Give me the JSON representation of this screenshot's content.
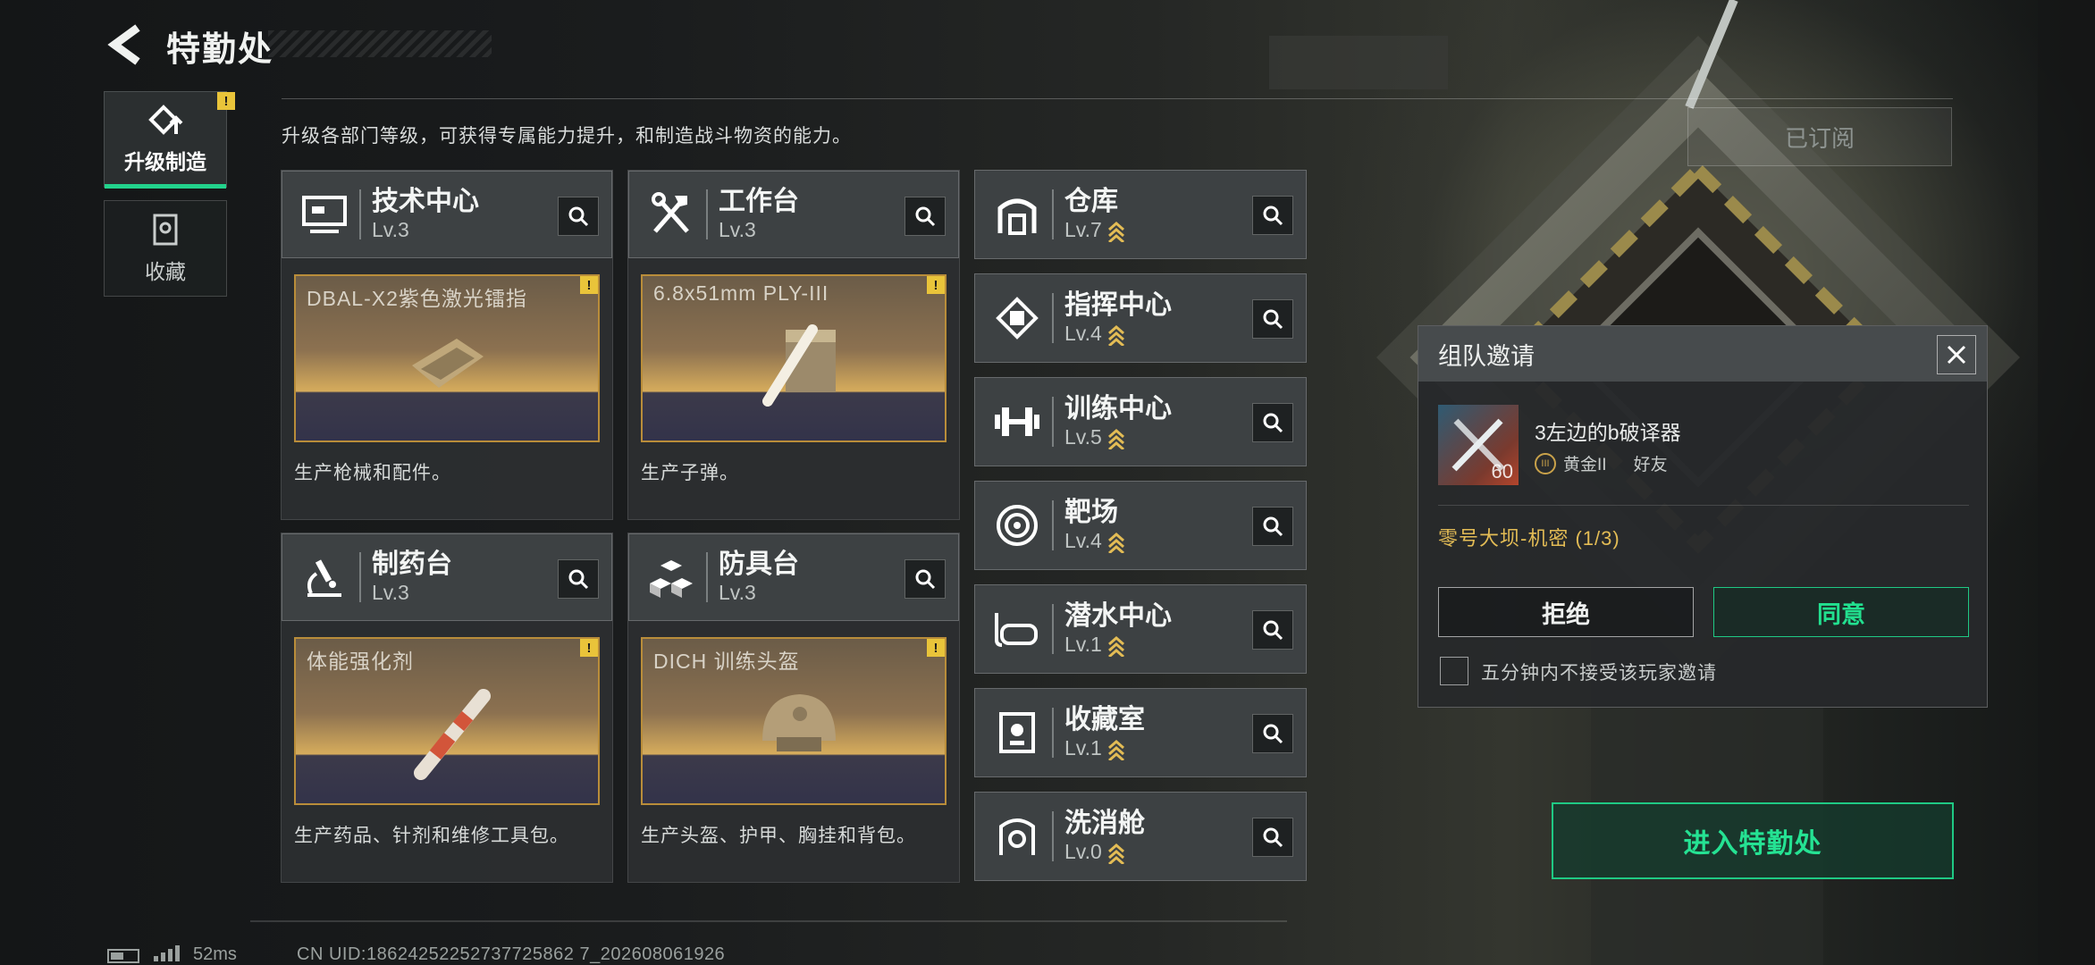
{
  "header": {
    "title": "特勤处"
  },
  "sidebar": {
    "tabs": [
      {
        "label": "升级制造"
      },
      {
        "label": "收藏"
      }
    ]
  },
  "description": "升级各部门等级，可获得专属能力提升，和制造战斗物资的能力。",
  "subscribed_label": "已订阅",
  "departments_large": [
    {
      "name": "技术中心",
      "level": "Lv.3",
      "product": "DBAL-X2紫色激光镭指",
      "desc": "生产枪械和配件。",
      "icon": "monitor-icon"
    },
    {
      "name": "工作台",
      "level": "Lv.3",
      "product": "6.8x51mm PLY-III",
      "desc": "生产子弹。",
      "icon": "tools-icon"
    },
    {
      "name": "制药台",
      "level": "Lv.3",
      "product": "体能强化剂",
      "desc": "生产药品、针剂和维修工具包。",
      "icon": "microscope-icon"
    },
    {
      "name": "防具台",
      "level": "Lv.3",
      "product": "DICH 训练头盔",
      "desc": "生产头盔、护甲、胸挂和背包。",
      "icon": "boxes-icon"
    }
  ],
  "departments_small": [
    {
      "name": "仓库",
      "level": "Lv.7",
      "icon": "warehouse-icon"
    },
    {
      "name": "指挥中心",
      "level": "Lv.4",
      "icon": "command-chip-icon"
    },
    {
      "name": "训练中心",
      "level": "Lv.5",
      "icon": "dumbbell-icon"
    },
    {
      "name": "靶场",
      "level": "Lv.4",
      "icon": "target-icon"
    },
    {
      "name": "潜水中心",
      "level": "Lv.1",
      "icon": "diving-mask-icon"
    },
    {
      "name": "收藏室",
      "level": "Lv.1",
      "icon": "collection-icon"
    },
    {
      "name": "洗消舱",
      "level": "Lv.0",
      "icon": "decontamination-icon"
    }
  ],
  "invite": {
    "title": "组队邀请",
    "player_name": "3左边的b破译器",
    "avatar_level": "60",
    "rank": "黄金II",
    "relation": "好友",
    "mode": "零号大坝-机密 (1/3)",
    "reject_label": "拒绝",
    "accept_label": "同意",
    "mute_label": "五分钟内不接受该玩家邀请"
  },
  "enter_label": "进入特勤处",
  "footer": {
    "ping": "52ms",
    "uid": "CN UID:18624252252737725862 7_202608061926"
  },
  "colors": {
    "accent": "#22d38c",
    "warning": "#e9c43a",
    "gold": "#e3bc55"
  }
}
